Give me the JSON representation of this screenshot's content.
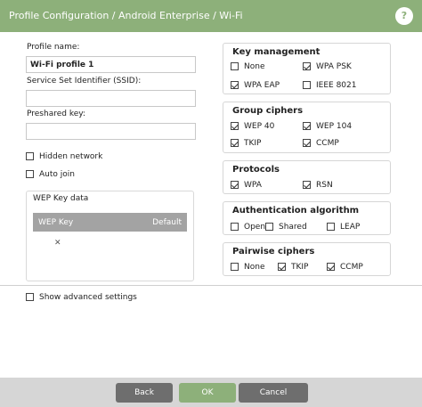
{
  "window": {
    "title": "Profile Configuration / Android Enterprise / Wi-Fi",
    "help_label": "?"
  },
  "form": {
    "profile_name_label": "Profile name:",
    "profile_name_value": "Wi-Fi profile 1",
    "ssid_label": "Service Set Identifier (SSID):",
    "ssid_value": "",
    "preshared_key_label": "Preshared key:",
    "preshared_key_value": "",
    "hidden_network_label": "Hidden network",
    "hidden_network_checked": false,
    "auto_join_label": "Auto join",
    "auto_join_checked": false
  },
  "wep_key_data": {
    "title": "WEP Key data",
    "col_key": "WEP Key",
    "col_default": "Default",
    "gadget_icon": "cross-tools-icon"
  },
  "key_management": {
    "title": "Key management",
    "options": [
      {
        "label": "None",
        "checked": false
      },
      {
        "label": "WPA PSK",
        "checked": true
      },
      {
        "label": "WPA EAP",
        "checked": true
      },
      {
        "label": "IEEE 8021",
        "checked": false
      }
    ]
  },
  "group_ciphers": {
    "title": "Group ciphers",
    "options": [
      {
        "label": "WEP 40",
        "checked": true
      },
      {
        "label": "WEP 104",
        "checked": true
      },
      {
        "label": "TKIP",
        "checked": true
      },
      {
        "label": "CCMP",
        "checked": true
      }
    ]
  },
  "protocols": {
    "title": "Protocols",
    "options": [
      {
        "label": "WPA",
        "checked": true
      },
      {
        "label": "RSN",
        "checked": true
      }
    ]
  },
  "authentication_algorithm": {
    "title": "Authentication algorithm",
    "options": [
      {
        "label": "Open",
        "checked": false
      },
      {
        "label": "Shared",
        "checked": false
      },
      {
        "label": "LEAP",
        "checked": false
      }
    ]
  },
  "pairwise_ciphers": {
    "title": "Pairwise ciphers",
    "options": [
      {
        "label": "None",
        "checked": false
      },
      {
        "label": "TKIP",
        "checked": true
      },
      {
        "label": "CCMP",
        "checked": true
      }
    ]
  },
  "advanced": {
    "label": "Show advanced settings",
    "checked": false
  },
  "footer": {
    "back_label": "Back",
    "ok_label": "OK",
    "cancel_label": "Cancel"
  },
  "colors": {
    "accent": "#8db07a",
    "button_grey": "#6e6e6e",
    "footer_bg": "#d6d6d6"
  }
}
